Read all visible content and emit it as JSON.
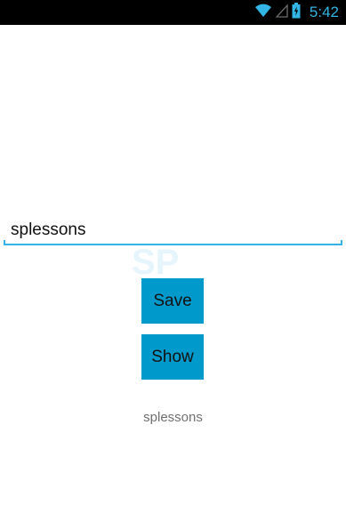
{
  "status_bar": {
    "time": "5:42",
    "icons": [
      "wifi-icon",
      "signal-icon",
      "battery-icon"
    ],
    "accent_color": "#33b5e5"
  },
  "input": {
    "value": "splessons"
  },
  "buttons": {
    "save_label": "Save",
    "show_label": "Show",
    "color": "#0099cc"
  },
  "output": {
    "text": "splessons"
  },
  "watermark": {
    "text": "SPLESSONS",
    "logo_letters": "SP"
  }
}
